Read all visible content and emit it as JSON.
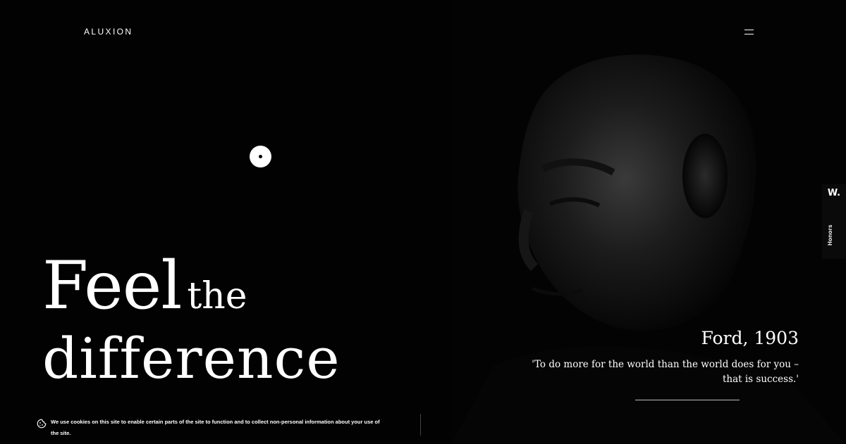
{
  "header": {
    "logo_text": "ALUXION",
    "menu_icon": "hamburger-icon"
  },
  "hero": {
    "headline_word_1": "Feel",
    "headline_word_2": "the",
    "headline_line_2": "difference"
  },
  "quote": {
    "author": "Ford, 1903",
    "text": "'To do more for the world than the world does for you – that is success.'"
  },
  "awards_badge": {
    "mark": "W.",
    "label": "Honors"
  },
  "cookie_notice": {
    "icon": "cookie-icon",
    "text": "We use cookies on this site to enable certain parts of the site to function and to collect non-personal information about your use of the site."
  },
  "colors": {
    "background": "#000000",
    "text": "#ffffff",
    "rule": "#bdbdbd"
  }
}
